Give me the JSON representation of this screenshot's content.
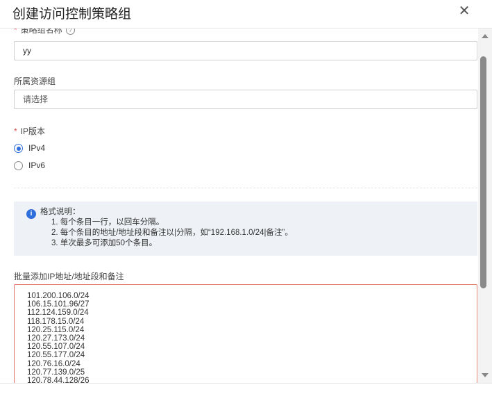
{
  "dialog": {
    "title": "创建访问控制策略组",
    "close_icon": "✕"
  },
  "form": {
    "name_field": {
      "label": "策略组名称",
      "required": "*",
      "help_icon": "?",
      "value": "yy"
    },
    "resource_group": {
      "label": "所属资源组",
      "placeholder": "请选择"
    },
    "ip_version": {
      "label": "IP版本",
      "required": "*",
      "options": [
        {
          "label": "IPv4",
          "selected": true
        },
        {
          "label": "IPv6",
          "selected": false
        }
      ]
    },
    "notice": {
      "icon": "i",
      "title": "格式说明：",
      "lines": [
        "1. 每个条目一行，以回车分隔。",
        "2. 每个条目的地址/地址段和备注以|分隔，如“192.168.1.0/24|备注”。",
        "3. 单次最多可添加50个条目。"
      ]
    },
    "batch_add": {
      "label": "批量添加IP地址/地址段和备注",
      "entries": [
        "101.200.106.0/24",
        "106.15.101.96/27",
        "112.124.159.0/24",
        "118.178.15.0/24",
        "120.25.115.0/24",
        "120.27.173.0/24",
        "120.55.107.0/24",
        "120.55.177.0/24",
        "120.76.16.0/24",
        "120.77.139.0/25",
        "120.78.44.128/26"
      ]
    }
  },
  "colors": {
    "primary": "#2f6fdb",
    "required": "#e34d4d",
    "error_border": "#e07a6e"
  }
}
